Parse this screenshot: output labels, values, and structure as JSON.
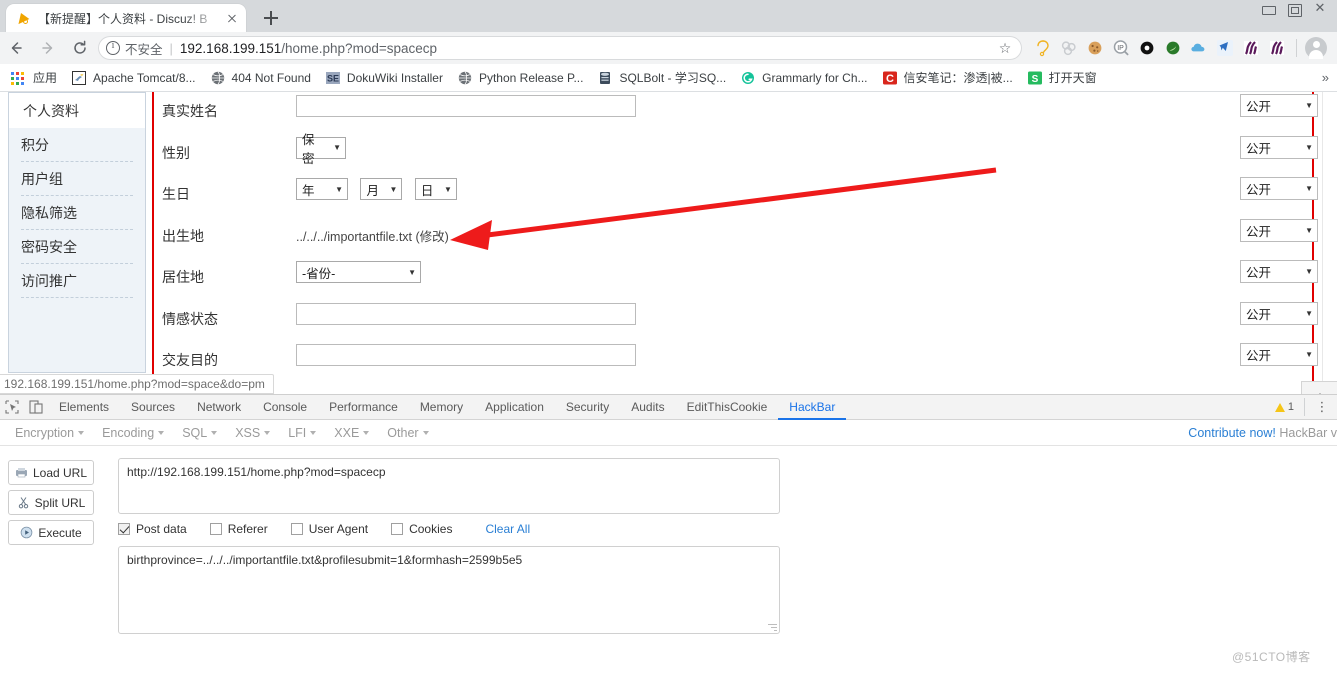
{
  "window": {
    "controls": [
      "minimize",
      "maximize",
      "close"
    ]
  },
  "tab": {
    "title": "【新提醒】个人资料 - Discuz! B",
    "favicon": "discuz-favicon",
    "close_label": "×",
    "newtab_label": "+"
  },
  "omnibox": {
    "security_label": "不安全",
    "separator": "|",
    "url_host": "192.168.199.151",
    "url_path": "/home.php?mod=spacecp",
    "star": "☆"
  },
  "nav": {
    "back": "back-arrow",
    "forward": "forward-arrow",
    "reload": "reload-arrow"
  },
  "extensions": [
    {
      "name": "magnifier-lasso-icon"
    },
    {
      "name": "link-chain-icon"
    },
    {
      "name": "cookie-icon"
    },
    {
      "name": "ip-lookup-icon",
      "label": "IP"
    },
    {
      "name": "black-ring-icon"
    },
    {
      "name": "green-circle-icon"
    },
    {
      "name": "cloud-icon"
    },
    {
      "name": "blue-bird-icon"
    },
    {
      "name": "purple-ss-icon-1"
    },
    {
      "name": "purple-ss-icon-2"
    }
  ],
  "bookmarks": {
    "apps_label": "应用",
    "items": [
      {
        "label": "Apache Tomcat/8...",
        "icon": "tomcat-icon"
      },
      {
        "label": "404 Not Found",
        "icon": "globe-icon"
      },
      {
        "label": "DokuWiki Installer",
        "icon": "se-icon"
      },
      {
        "label": "Python Release P...",
        "icon": "globe-icon"
      },
      {
        "label": "SQLBolt - 学习SQ...",
        "icon": "database-icon"
      },
      {
        "label": "Grammarly for Ch...",
        "icon": "grammarly-icon"
      },
      {
        "label": "信安笔记：渗透|被...",
        "icon": "c-red-icon"
      },
      {
        "label": "打开天窗",
        "icon": "s-green-icon"
      }
    ],
    "overflow": "»"
  },
  "page": {
    "sidebar": {
      "active": "个人资料",
      "items": [
        "积分",
        "用户组",
        "隐私筛选",
        "密码安全",
        "访问推广"
      ]
    },
    "form": {
      "privacy_value": "公开",
      "rows": [
        {
          "label": "真实姓名",
          "type": "text",
          "value": "",
          "privacy": "公开"
        },
        {
          "label": "性别",
          "type": "select",
          "value": "保密",
          "privacy": "公开"
        },
        {
          "label": "生日",
          "type": "date",
          "year": "年",
          "month": "月",
          "day": "日",
          "privacy": "公开"
        },
        {
          "label": "出生地",
          "type": "plain",
          "value": "../../../importantfile.txt (修改)",
          "privacy": "公开"
        },
        {
          "label": "居住地",
          "type": "select",
          "value": "-省份-",
          "privacy": "公开"
        },
        {
          "label": "情感状态",
          "type": "text",
          "value": "",
          "privacy": "公开"
        },
        {
          "label": "交友目的",
          "type": "text",
          "value": "",
          "privacy": "公开"
        }
      ]
    },
    "status_url": "192.168.199.151/home.php?mod=space&do=pm",
    "go_top": "scroll-to-top"
  },
  "devtools": {
    "tabs": [
      "Elements",
      "Sources",
      "Network",
      "Console",
      "Performance",
      "Memory",
      "Application",
      "Security",
      "Audits",
      "EditThisCookie",
      "HackBar"
    ],
    "active_tab": "HackBar",
    "warning_count": "1",
    "kebab": "⋮"
  },
  "hackbar": {
    "menus": [
      "Encryption",
      "Encoding",
      "SQL",
      "XSS",
      "LFI",
      "XXE",
      "Other"
    ],
    "contribute_link": "Contribute now!",
    "contribute_suffix": "HackBar v",
    "buttons": [
      {
        "label": "Load URL",
        "icon": "load-url-icon"
      },
      {
        "label": "Split URL",
        "icon": "split-url-icon"
      },
      {
        "label": "Execute",
        "icon": "execute-icon"
      }
    ],
    "url_value": "http://192.168.199.151/home.php?mod=spacecp",
    "options": [
      {
        "label": "Post data",
        "checked": true
      },
      {
        "label": "Referer",
        "checked": false
      },
      {
        "label": "User Agent",
        "checked": false
      },
      {
        "label": "Cookies",
        "checked": false
      }
    ],
    "clear_all": "Clear All",
    "post_data": "birthprovince=../../../importantfile.txt&profilesubmit=1&formhash=2599b5e5"
  },
  "watermark": "@51CTO博客",
  "colors": {
    "accent": "#1a73e8",
    "annotation_red": "#ee1b1b",
    "page_rule_red": "#e00000",
    "sidebar_bg": "#eef3f8"
  }
}
